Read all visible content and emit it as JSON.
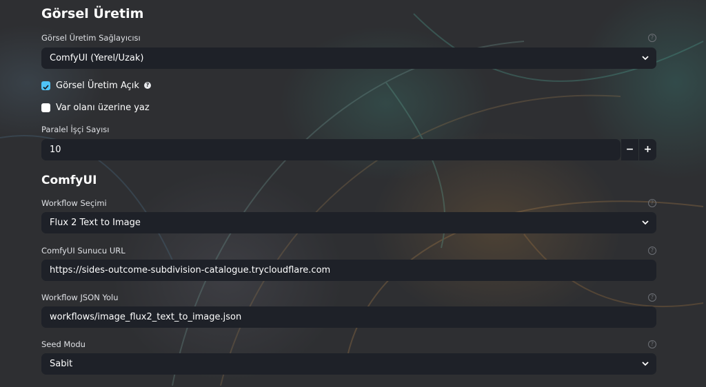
{
  "sections": {
    "image_generation_title": "Görsel Üretim",
    "comfyui_title": "ComfyUI"
  },
  "provider": {
    "label": "Görsel Üretim Sağlayıcısı",
    "value": "ComfyUI (Yerel/Uzak)"
  },
  "image_generation_enabled": {
    "label": "Görsel Üretim Açık",
    "checked": true
  },
  "overwrite_existing": {
    "label": "Var olanı üzerine yaz",
    "checked": false
  },
  "parallel_workers": {
    "label": "Paralel İşçi Sayısı",
    "value": "10",
    "minus": "−",
    "plus": "+"
  },
  "workflow_selection": {
    "label": "Workflow Seçimi",
    "value": "Flux 2 Text to Image"
  },
  "server_url": {
    "label": "ComfyUI Sunucu URL",
    "value": "https://sides-outcome-subdivision-catalogue.trycloudflare.com"
  },
  "workflow_json_path": {
    "label": "Workflow JSON Yolu",
    "value": "workflows/image_flux2_text_to_image.json"
  },
  "seed_mode": {
    "label": "Seed Modu",
    "value": "Sabit"
  },
  "help_glyph": "?",
  "icons": {
    "dropdown": "chevron-down-icon",
    "help": "question-circle-icon",
    "check": "checkmark-icon"
  },
  "colors": {
    "accent": "#4fc3f7",
    "field_bg": "#1e2128",
    "text": "#ffffff"
  }
}
